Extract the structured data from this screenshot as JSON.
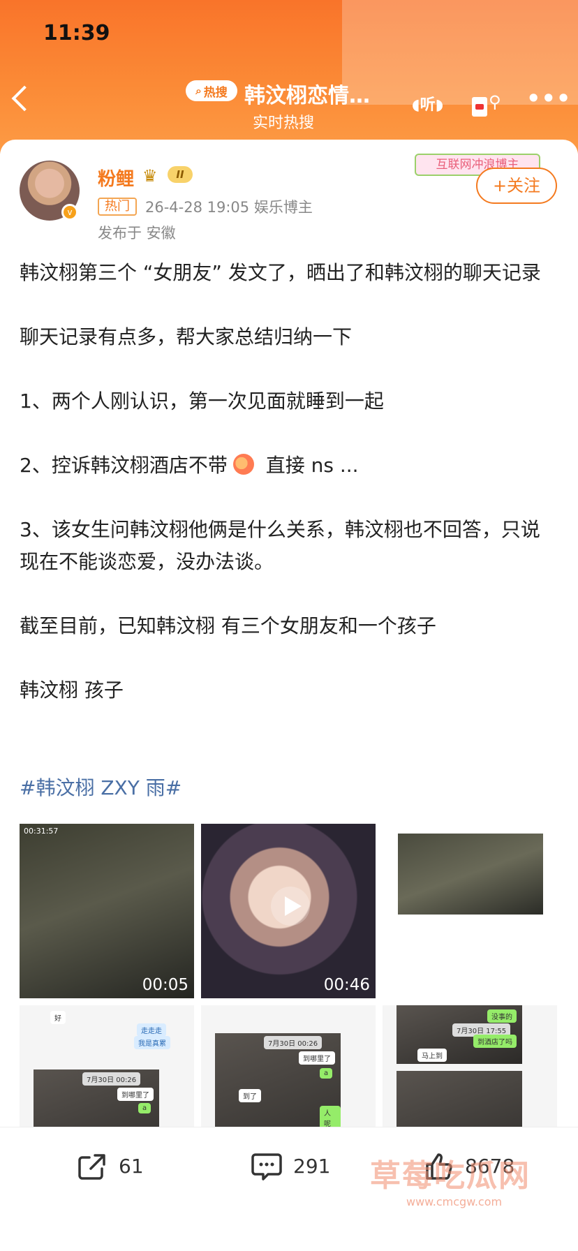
{
  "status_bar": {
    "time": "11:39"
  },
  "header": {
    "hot_label": "热搜",
    "title": "韩汶栩恋情…",
    "subtitle": "实时热搜",
    "listen_label": "听"
  },
  "post": {
    "author": "粉鲤",
    "level": "II",
    "hot_tag": "热门",
    "meta": "26-4-28 19:05  娱乐博主",
    "location": "发布于 安徽",
    "deco_label": "互联网冲浪博主",
    "follow_label": "+关注",
    "paragraphs": [
      "韩汶栩第三个 “女朋友” 发文了，晒出了和韩汶栩的聊天记录",
      "聊天记录有点多，帮大家总结归纳一下",
      "1、两个人刚认识，第一次见面就睡到一起",
      "3、该女生问韩汶栩他俩是什么关系，韩汶栩也不回答，只说现在不能谈恋爱，没办法谈。",
      "截至目前，已知韩汶栩 有三个女朋友和一个孩子",
      "韩汶栩 孩子"
    ],
    "p2_before": "2、控诉韩汶栩酒店不带",
    "p2_after": " 直接 ns ...",
    "hashtag": "#韩汶栩 ZXY 雨#",
    "media": {
      "tile1_time": "00:31:57",
      "tile1_duration": "00:05",
      "tile2_duration": "00:46",
      "chat": {
        "b1": "好",
        "b2": "走走走",
        "b3": "我是真累",
        "b4": "到哪里了",
        "b5": "a",
        "b6": "到了",
        "b7": "人呢",
        "b8": "没事的",
        "b9": "到酒店了吗",
        "b10": "马上到",
        "date1": "7月30日 00:26",
        "date2": "7月30日 00:26",
        "date3": "7月30日 17:55"
      }
    }
  },
  "actions": {
    "share_count": "61",
    "comment_count": "291",
    "like_count": "8678"
  },
  "watermark": {
    "text": "草莓吃瓜网",
    "url": "www.cmcgw.com"
  }
}
